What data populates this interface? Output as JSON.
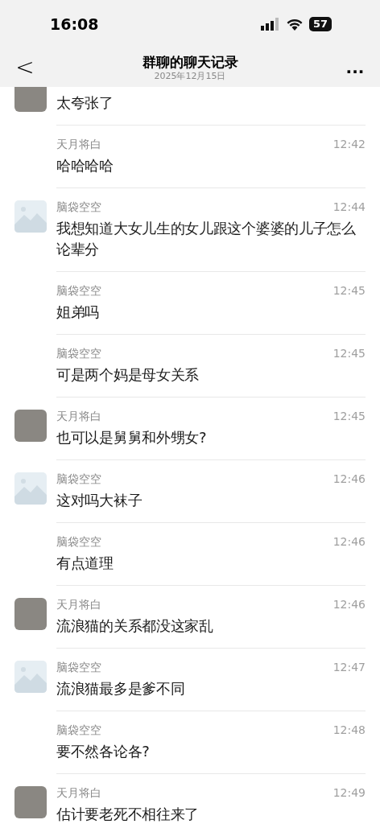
{
  "status_bar": {
    "time": "16:08",
    "battery": "57"
  },
  "nav": {
    "back": "<",
    "title": "群聊的聊天记录",
    "subtitle": "2025年12月15日",
    "more": "..."
  },
  "messages": [
    {
      "kind": "photo",
      "text": "太夸张了",
      "clipped": true
    },
    {
      "kind": "plain",
      "name": "天月将白",
      "time": "12:42",
      "text": "哈哈哈哈",
      "clipped": false
    },
    {
      "kind": "placeholder",
      "name": "脑袋空空",
      "time": "12:44",
      "text": "我想知道大女儿生的女儿跟这个婆婆的儿子怎么论辈分",
      "clipped": false
    },
    {
      "kind": "plain",
      "name": "脑袋空空",
      "time": "12:45",
      "text": "姐弟吗",
      "clipped": false
    },
    {
      "kind": "plain",
      "name": "脑袋空空",
      "time": "12:45",
      "text": "可是两个妈是母女关系",
      "clipped": false
    },
    {
      "kind": "photo",
      "name": "天月将白",
      "time": "12:45",
      "text": "也可以是舅舅和外甥女?",
      "clipped": false
    },
    {
      "kind": "placeholder",
      "name": "脑袋空空",
      "time": "12:46",
      "text": "这对吗大袜子",
      "clipped": false
    },
    {
      "kind": "plain",
      "name": "脑袋空空",
      "time": "12:46",
      "text": "有点道理",
      "clipped": false
    },
    {
      "kind": "photo",
      "name": "天月将白",
      "time": "12:46",
      "text": "流浪猫的关系都没这家乱",
      "clipped": false
    },
    {
      "kind": "placeholder",
      "name": "脑袋空空",
      "time": "12:47",
      "text": "流浪猫最多是爹不同",
      "clipped": false
    },
    {
      "kind": "plain",
      "name": "脑袋空空",
      "time": "12:48",
      "text": "要不然各论各?",
      "clipped": false
    },
    {
      "kind": "photo",
      "name": "天月将白",
      "time": "12:49",
      "text": "估计要老死不相往来了",
      "clipped": false
    }
  ]
}
